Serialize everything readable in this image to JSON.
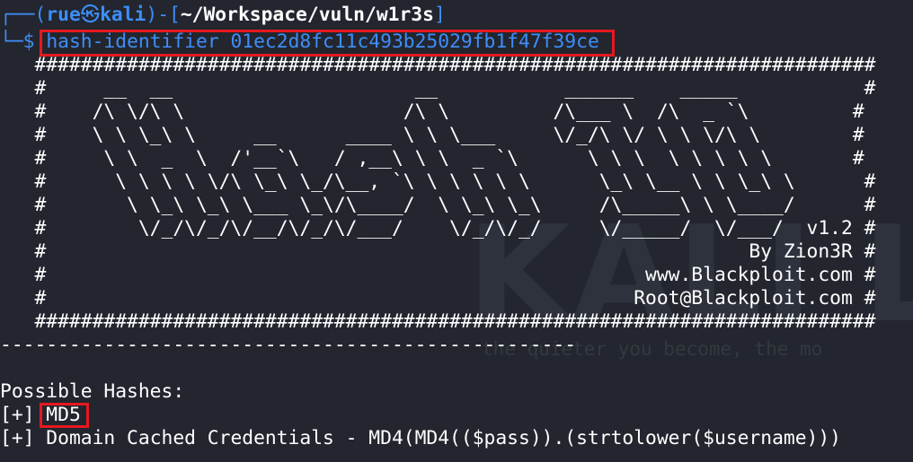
{
  "prompt": {
    "frame_top": "┌──(",
    "user": "rue",
    "skull": "㉿",
    "host": "kali",
    "frame_mid": ")-[",
    "path": "~/Workspace/vuln/w1r3s",
    "frame_end": "]",
    "frame_bottom": "└─",
    "dollar": "$",
    "command": "hash-identifier 01ec2d8fc11c493b25029fb1f47f39ce"
  },
  "banner_lines": [
    "   #########################################################################",
    "   #     __  __                     __           ______    _____           #",
    "   #    /\\ \\/\\ \\                   /\\ \\         /\\___ \\  /\\  _ `\\         #",
    "   #    \\ \\ \\_\\ \\     __      ____ \\ \\ \\___     \\/_/\\ \\/ \\ \\ \\/\\ \\        #",
    "   #     \\ \\  _  \\  /'__`\\   / ,__\\ \\ \\  _ `\\      \\ \\ \\  \\ \\ \\ \\ \\       #",
    "   #      \\ \\ \\ \\ \\/\\ \\_\\ \\_/\\__, `\\ \\ \\ \\ \\ \\      \\_\\ \\__ \\ \\ \\_\\ \\      #",
    "   #       \\ \\_\\ \\_\\ \\___ \\_\\/\\____/  \\ \\_\\ \\_\\     /\\_____\\ \\ \\____/      #",
    "   #        \\/_/\\/_/\\/__/\\/_/\\/___/    \\/_/\\/_/     \\/_____/  \\/___/  v1.2 #",
    "   #                                                             By Zion3R #",
    "   #                                                    www.Blackploit.com #",
    "   #                                                   Root@Blackploit.com #",
    "   #########################################################################"
  ],
  "separator": "--------------------------------------------------",
  "blank": "",
  "results_title": "Possible Hashes:",
  "results": [
    {
      "prefix": "[+] ",
      "value": "MD5"
    },
    {
      "prefix": "[+] ",
      "value": "Domain Cached Credentials - MD4(MD4(($pass)).(strtolower($username)))"
    }
  ],
  "watermark": {
    "logo": "KALI LI",
    "tagline": "the quieter you become, the mo"
  },
  "colors": {
    "background": "#23262f",
    "prompt_blue": "#3e8ef7",
    "highlight_red": "#e5191f",
    "text": "#ffffff"
  }
}
